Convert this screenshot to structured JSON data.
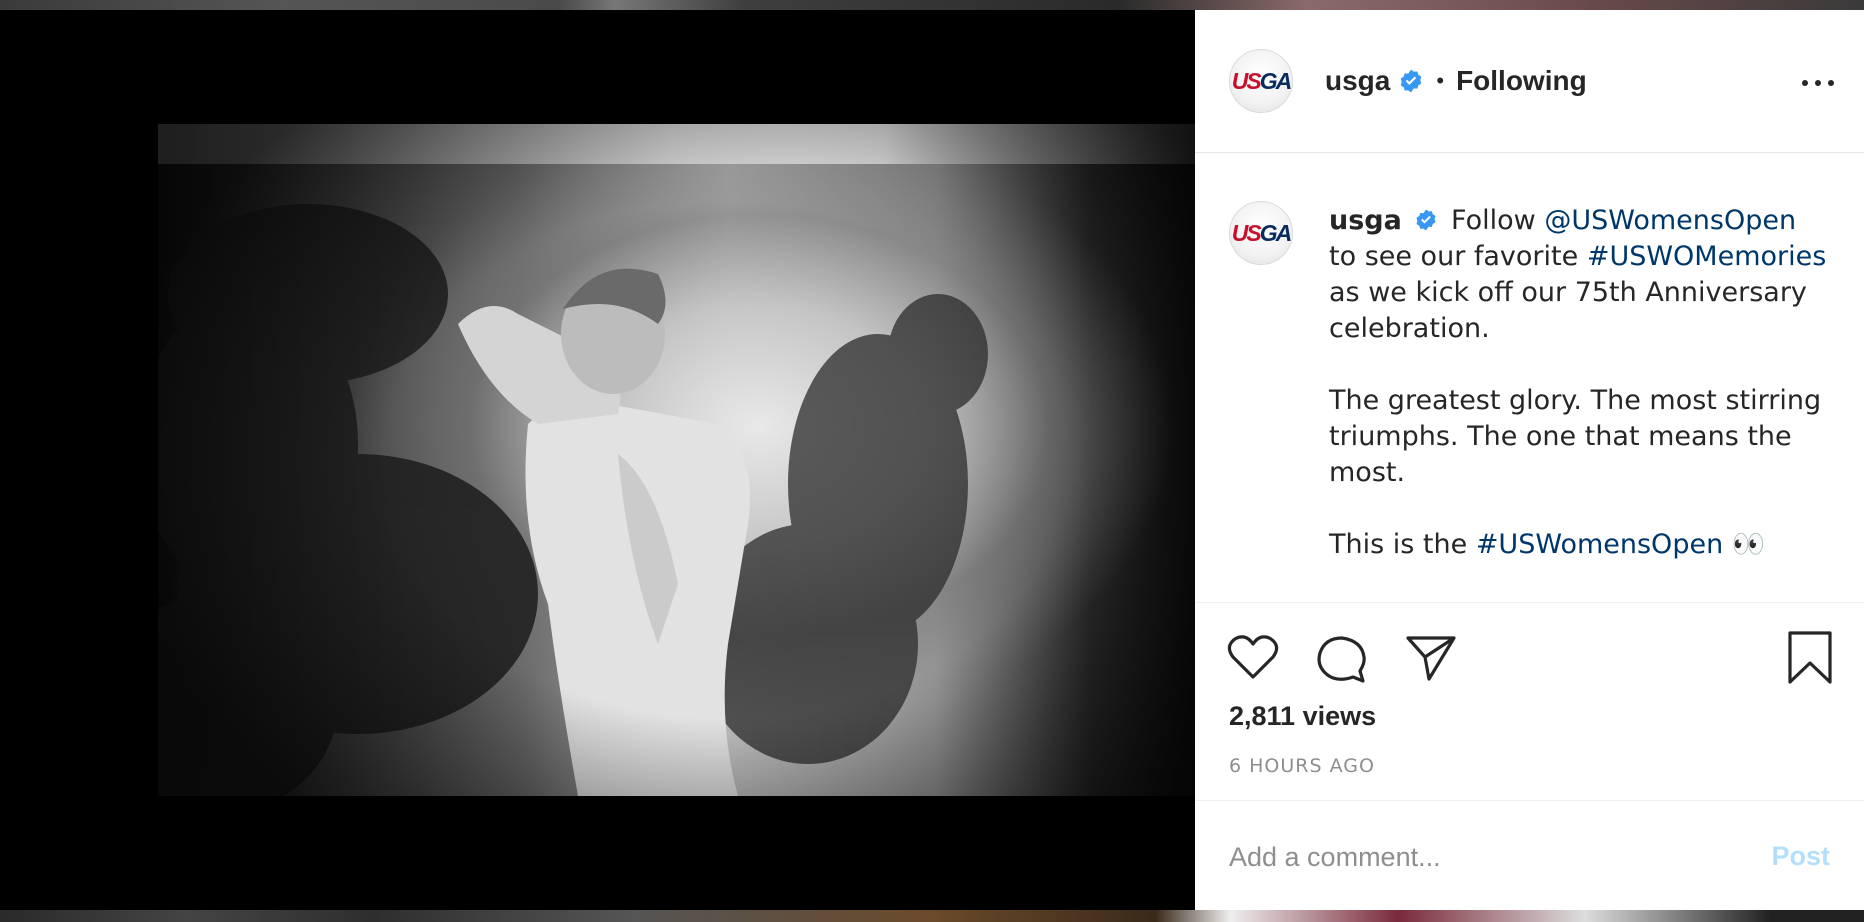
{
  "post": {
    "username": "usga",
    "follow_status": "Following",
    "separator": "•",
    "avatar_text": {
      "part1": "US",
      "part2": "GA"
    },
    "caption": {
      "username": "usga",
      "p1_text1": "Follow",
      "p1_link1": "@USWomensOpen",
      "p1_text2": "to see our favorite",
      "p1_link2": "#USWOMemories",
      "p1_text3": "as we kick off our 75th Anniversary celebration.",
      "p2": "The greatest glory. The most stirring triumphs. The one that means the most.",
      "p3_text": "This is the",
      "p3_link": "#USWomensOpen",
      "p3_emoji": "👀"
    },
    "views": "2,811 views",
    "timestamp": "6 HOURS AGO",
    "comment": {
      "placeholder": "Add a comment...",
      "post_label": "Post"
    }
  },
  "icons": {
    "more": "more-options-icon",
    "verified": "verified-badge-icon",
    "like": "heart-icon",
    "comment": "comment-icon",
    "share": "paper-plane-icon",
    "save": "bookmark-icon"
  },
  "colors": {
    "link": "#00376b",
    "verified": "#3897f0",
    "post_disabled": "#b3dffc",
    "secondary_text": "#8e8e8e"
  }
}
